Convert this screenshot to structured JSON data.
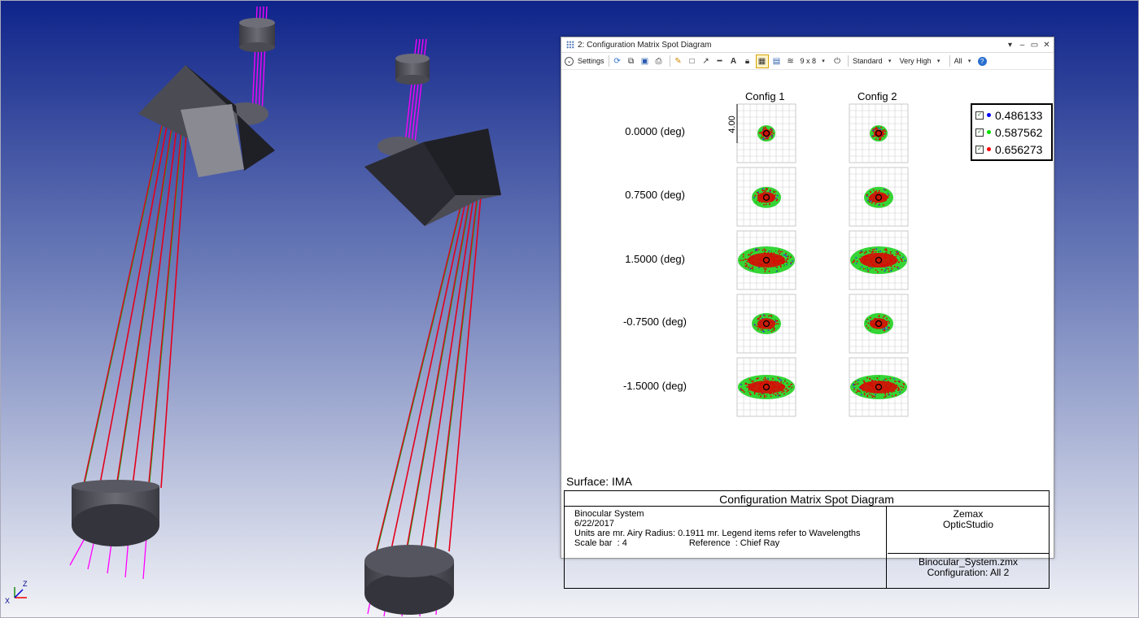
{
  "window": {
    "title": "2: Configuration Matrix Spot Diagram",
    "controls": [
      "▾",
      "–",
      "▭",
      "✕"
    ]
  },
  "toolbar": {
    "settings_label": "Settings",
    "grid_size": "9 x 8",
    "standard_label": "Standard",
    "quality_label": "Very High",
    "all_label": "All"
  },
  "plot": {
    "config_labels": [
      "Config 1",
      "Config 2"
    ],
    "field_labels": [
      "0.0000 (deg)",
      "0.7500 (deg)",
      "1.5000 (deg)",
      "-0.7500 (deg)",
      "-1.5000 (deg)"
    ],
    "scale_label": "4.00",
    "legend": [
      {
        "value": "0.486133",
        "color": "#0000ff"
      },
      {
        "value": "0.587562",
        "color": "#00e000"
      },
      {
        "value": "0.656273",
        "color": "#ff0000"
      }
    ],
    "surface_label": "Surface: IMA"
  },
  "info": {
    "title": "Configuration Matrix Spot Diagram",
    "line1": "Binocular System",
    "line2": "6/22/2017",
    "line3": "Units are mr. Airy Radius: 0.1911 mr. Legend items refer to Wavelengths",
    "scale_bar": "Scale bar  : 4",
    "reference": "Reference  : Chief Ray",
    "vendor": "Zemax",
    "product": "OpticStudio",
    "file": "Binocular_System.zmx",
    "configuration": "Configuration: All 2"
  },
  "axes_triad": {
    "x": "X",
    "z": "Z"
  }
}
